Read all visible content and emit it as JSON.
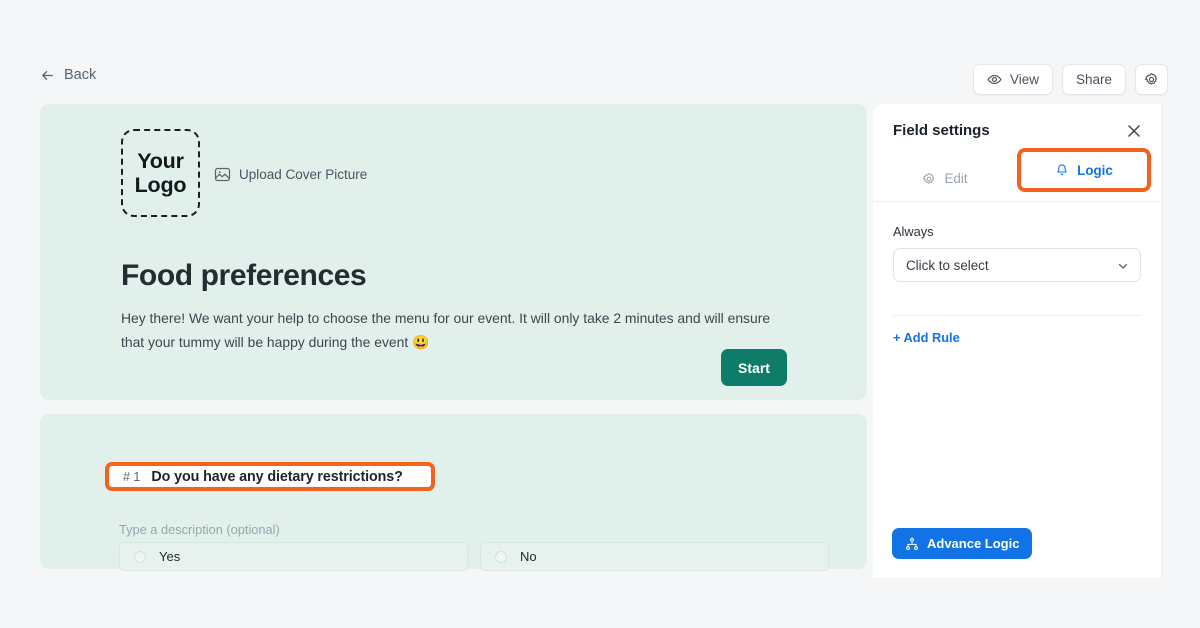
{
  "topbar": {
    "back_label": "Back",
    "back_icon": "arrow-left-icon",
    "view_label": "View",
    "view_icon": "eye-icon",
    "share_label": "Share",
    "settings_icon": "gear-icon"
  },
  "hero": {
    "logo_line1": "Your",
    "logo_line2": "Logo",
    "upload_label": "Upload Cover Picture",
    "upload_icon": "image-icon",
    "title": "Food preferences",
    "description": "Hey there! We want your help to choose the menu for our event. It will only take 2 minutes and will ensure that your tummy will be happy during the event 😃",
    "start_label": "Start"
  },
  "question": {
    "number": "# 1",
    "title": "Do you have any dietary restrictions?",
    "description_placeholder": "Type a description (optional)",
    "options": [
      {
        "label": "Yes"
      },
      {
        "label": "No"
      }
    ]
  },
  "panel": {
    "title": "Field settings",
    "close_icon": "close-icon",
    "tabs": [
      {
        "label": "Edit",
        "icon": "gear-icon",
        "active": false
      },
      {
        "label": "Logic",
        "icon": "bell-icon",
        "active": true
      }
    ],
    "condition_label": "Always",
    "select_value": "Click to select",
    "select_icon": "chevron-down-icon",
    "add_rule_label": "+ Add Rule",
    "advance_logic_label": "Advance Logic",
    "advance_logic_icon": "hierarchy-icon"
  },
  "colors": {
    "page_background": "#f4f6f8",
    "card_background": "#e2f0ec",
    "accent_orange": "#f4631e",
    "accent_blue": "#1273e6",
    "start_teal": "#0f7c6a"
  }
}
